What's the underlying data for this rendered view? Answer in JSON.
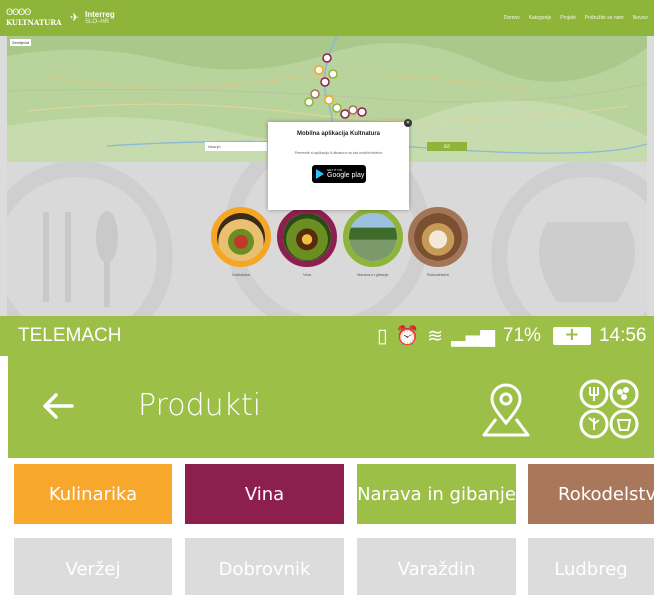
{
  "website": {
    "nav": {
      "logo_rings": "ʘʘʘʘ",
      "logo_text": "KULTNATURA",
      "interreg_title": "Interreg",
      "interreg_sub": "SLO–HR",
      "menu": [
        "Domov",
        "Kategorije",
        "Projekt",
        "Pridružite se nam",
        "Novice"
      ]
    },
    "map": {
      "hint": "Zemljevid",
      "search_placeholder": "Iskanje",
      "search_button": "Išči"
    },
    "popup": {
      "title": "Mobilna aplikacija Kultnatura",
      "text": "Prenesite si aplikacijo Kultnatura na vaš mobilni telefon",
      "store_small": "GET IT ON",
      "store_big": "Google play"
    },
    "categories": [
      {
        "label": "Kulinarika",
        "color": "#f5a623"
      },
      {
        "label": "Vina",
        "color": "#8c1f4e"
      },
      {
        "label": "Narava in gibanje",
        "color": "#8fb43a"
      },
      {
        "label": "Rokodelstvo",
        "color": "#a47458"
      }
    ]
  },
  "status_bar": {
    "carrier": "TELEMACH",
    "battery_percent": "71%",
    "time": "14:56"
  },
  "app_bar": {
    "title": "Produkti",
    "back_icon": "arrow-left-icon",
    "map_icon": "map-pin-icon",
    "categories_icon": "category-grid-icon"
  },
  "tabs": [
    {
      "label": "Kulinarika",
      "color": "#f7a72b"
    },
    {
      "label": "Vina",
      "color": "#8c1f4e"
    },
    {
      "label": "Narava in gibanje",
      "color": "#9cbf48"
    },
    {
      "label": "Rokodelstvo",
      "color": "#a9785c"
    }
  ],
  "cities": [
    "Veržej",
    "Dobrovnik",
    "Varaždin",
    "Ludbreg"
  ],
  "colors": {
    "accent": "#9cbf48",
    "city_bg": "#dcdcdc"
  }
}
